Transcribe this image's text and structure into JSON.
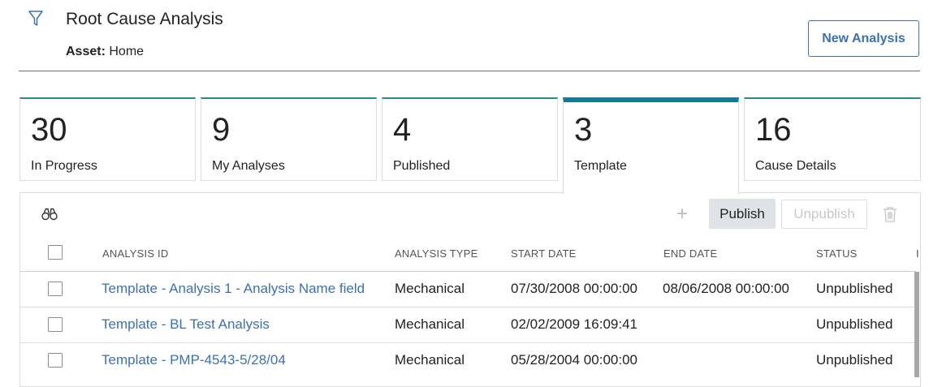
{
  "header": {
    "title": "Root Cause Analysis",
    "asset_label": "Asset:",
    "asset_value": "Home",
    "new_button": "New Analysis",
    "filter_icon": "filter-icon"
  },
  "tiles": [
    {
      "count": "30",
      "label": "In Progress"
    },
    {
      "count": "9",
      "label": "My Analyses"
    },
    {
      "count": "4",
      "label": "Published"
    },
    {
      "count": "3",
      "label": "Template",
      "active": true
    },
    {
      "count": "16",
      "label": "Cause Details"
    }
  ],
  "toolbar": {
    "search_icon": "binoculars-icon",
    "add_icon": "plus-icon",
    "publish": "Publish",
    "unpublish": "Unpublish",
    "delete_icon": "trash-icon"
  },
  "table": {
    "columns": [
      "ANALYSIS ID",
      "ANALYSIS TYPE",
      "START DATE",
      "END DATE",
      "STATUS",
      "I"
    ],
    "rows": [
      {
        "id": "Template - Analysis 1 - Analysis Name field",
        "type": "Mechanical",
        "start": "07/30/2008 00:00:00",
        "end": "08/06/2008 00:00:00",
        "status": "Unpublished"
      },
      {
        "id": "Template - BL Test Analysis",
        "type": "Mechanical",
        "start": "02/02/2009 16:09:41",
        "end": "",
        "status": "Unpublished"
      },
      {
        "id": "Template - PMP-4543-5/28/04",
        "type": "Mechanical",
        "start": "05/28/2004 00:00:00",
        "end": "",
        "status": "Unpublished"
      }
    ]
  },
  "colors": {
    "accent": "#3d70b2",
    "tile_border": "#137c94"
  }
}
